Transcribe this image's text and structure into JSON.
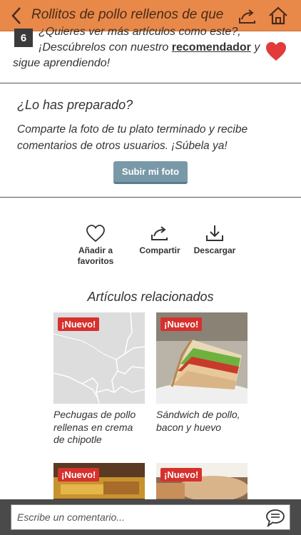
{
  "header": {
    "title": "Rollitos de pollo rellenos de que"
  },
  "step": {
    "number": "6",
    "line1": "¿Quieres ver más artículos como este?,",
    "line2_prefix": "¡Descúbrelos con nuestro ",
    "line2_link": "recomendador",
    "line2_suffix": " y",
    "line3": "sigue aprendiendo!"
  },
  "prepared": {
    "title": "¿Lo has preparado?",
    "text": "Comparte la foto de tu plato terminado y recibe comentarios de otros usuarios. ¡Súbela ya!",
    "button": "Subir mi foto"
  },
  "actions": {
    "favorite_label": "Añadir a favoritos",
    "share_label": "Compartir",
    "download_label": "Descargar"
  },
  "related": {
    "title": "Artículos relacionados",
    "items": [
      {
        "badge": "¡Nuevo!",
        "caption": "Pechugas de pollo rellenas en crema de chipotle"
      },
      {
        "badge": "¡Nuevo!",
        "caption": "Sándwich de pollo, bacon y huevo"
      },
      {
        "badge": "¡Nuevo!",
        "caption": ""
      },
      {
        "badge": "¡Nuevo!",
        "caption": ""
      }
    ]
  },
  "comment": {
    "placeholder": "Escribe un comentario..."
  },
  "colors": {
    "header_bg": "#e8894a",
    "badge_red": "#d6312d",
    "button_bg": "#7999a9",
    "comment_bar": "#4a4a4a"
  }
}
